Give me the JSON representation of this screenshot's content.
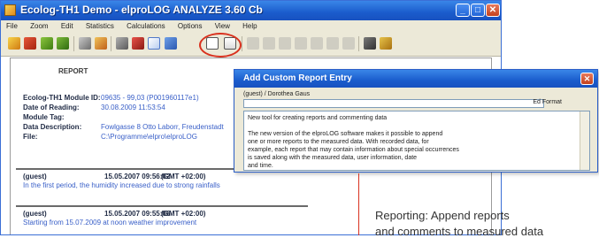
{
  "window": {
    "title": "Ecolog-TH1 Demo - elproLOG ANALYZE 3.60 Cb",
    "minimize": "_",
    "maximize": "□",
    "close": "✕"
  },
  "menu": [
    "File",
    "Zoom",
    "Edit",
    "Statistics",
    "Calculations",
    "Options",
    "View",
    "Help"
  ],
  "toolbar_icons": [
    "open-icon",
    "save-icon",
    "import-icon",
    "export-icon",
    "settings-icon",
    "print-icon",
    "printer-icon",
    "chart-icon",
    "table-icon",
    "report-entry-icon",
    "append-report-icon",
    "undo-icon",
    "cut-icon",
    "copy-icon",
    "paste-icon",
    "grid-icon",
    "zoom-icon",
    "calendar-icon",
    "help-icon"
  ],
  "report": {
    "heading": "REPORT",
    "fields": [
      {
        "label": "Ecolog-TH1 Module ID:",
        "value": "09635 - 99,03 (P001960117e1)"
      },
      {
        "label": "Date of Reading:",
        "value": "30.08.2009 11:53:54"
      },
      {
        "label": "Module Tag:",
        "value": ""
      },
      {
        "label": "Data Description:",
        "value": "Fowlgasse 8 Otto Laborr, Freudenstadt"
      },
      {
        "label": "File:",
        "value": "C:\\Programme\\elpro\\elproLOG"
      }
    ],
    "entries": [
      {
        "user": "(guest)",
        "date": "15.05.2007 09:56:02",
        "tz": "(GMT +02:00)",
        "text": "In the first period, the humidity increased due to strong rainfalls"
      },
      {
        "user": "(guest)",
        "date": "15.05.2007 09:55:06",
        "tz": "(GMT +02:00)",
        "text": "Starting from 15.07.2009 at noon weather improvement"
      }
    ]
  },
  "dialog": {
    "title": "Add Custom Report Entry",
    "close": "✕",
    "user_label": "(guest) / Dorothea Gaus",
    "format_label": "Ed Format",
    "text_lines": [
      "New tool for creating reports and commenting data",
      "",
      "The new version of the elproLOG software makes it possible to append",
      "one or more reports to the measured data. With recorded data, for",
      "example, each report that may contain information about special occurrences",
      "is saved along with the measured data, user information, date",
      "and time."
    ]
  },
  "caption": {
    "line1": "Reporting: Append reports",
    "line2": "and comments to measured data"
  }
}
